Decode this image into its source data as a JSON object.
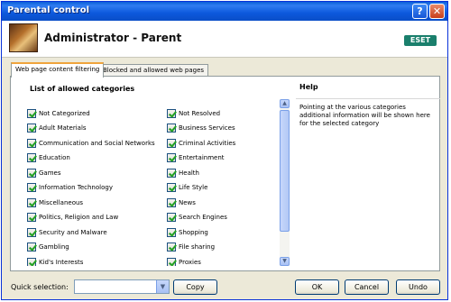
{
  "window": {
    "title": "Parental control",
    "help_glyph": "?",
    "close_glyph": "✕"
  },
  "header": {
    "title": "Administrator - Parent",
    "brand": "ESET"
  },
  "tabs": [
    {
      "label": "Web page content filtering",
      "active": true
    },
    {
      "label": "Blocked and allowed web pages",
      "active": false
    }
  ],
  "list": {
    "title": "List of allowed categories",
    "left_column": [
      "Not Categorized",
      "Adult Materials",
      "Communication and Social Networks",
      "Education",
      "Games",
      "Information Technology",
      "Miscellaneous",
      "Politics, Religion and Law",
      "Security and Malware",
      "Gambling",
      "Kid's Interests"
    ],
    "right_column": [
      "Not Resolved",
      "Business Services",
      "Criminal Activities",
      "Entertainment",
      "Health",
      "Life Style",
      "News",
      "Search Engines",
      "Shopping",
      "File sharing",
      "Proxies"
    ]
  },
  "help": {
    "title": "Help",
    "text": "Pointing at the various categories additional information will be shown here for the selected category"
  },
  "footer": {
    "quick_selection_label": "Quick selection:",
    "quick_selection_value": "",
    "copy_label": "Copy",
    "ok_label": "OK",
    "cancel_label": "Cancel",
    "undo_label": "Undo"
  },
  "colors": {
    "titlebar": "#0a5fd8",
    "check": "#21a121",
    "tab_highlight": "#f0a43c"
  }
}
